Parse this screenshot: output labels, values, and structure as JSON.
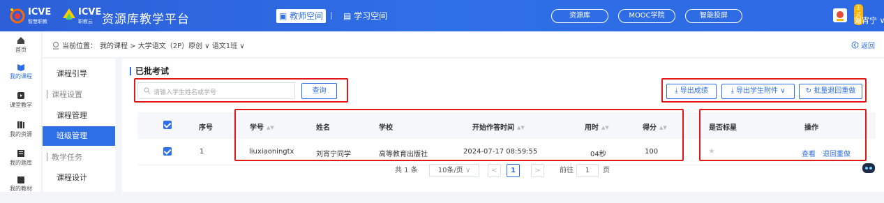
{
  "header": {
    "brand1_main": "ICVE",
    "brand1_sub": "智慧职教",
    "brand2_main": "ICVE",
    "brand2_sub": "职教云",
    "platform_title": "资源库教学平台",
    "teacher_space": "教师空间",
    "separator": "|",
    "study_space": "学习空间",
    "pills": [
      "资源库",
      "MOOC学院",
      "智能投屏"
    ],
    "user_badge": "正式版",
    "user_name": "刘宵宁 ∨"
  },
  "left_nav": [
    {
      "label": "首页",
      "icon": "home-icon"
    },
    {
      "label": "我的课程",
      "icon": "book-icon",
      "active": true
    },
    {
      "label": "课堂教学",
      "icon": "play-icon"
    },
    {
      "label": "我的资源",
      "icon": "resource-icon"
    },
    {
      "label": "我的题库",
      "icon": "question-bank-icon"
    },
    {
      "label": "我的教材",
      "icon": "textbook-icon"
    }
  ],
  "breadcrumb": {
    "prefix": "当前位置：",
    "path": "我的课程 > 大学语文（2P）原创 ∨ 语文1班 ∨",
    "back": "返回"
  },
  "sub_menu": [
    {
      "label": "课程引导",
      "type": "item"
    },
    {
      "label": "课程设置",
      "type": "group"
    },
    {
      "label": "课程管理",
      "type": "item"
    },
    {
      "label": "班级管理",
      "type": "item",
      "active": true
    },
    {
      "label": "教学任务",
      "type": "group"
    },
    {
      "label": "课程设计",
      "type": "item"
    }
  ],
  "content": {
    "section_title": "已批考试",
    "search_placeholder": "请输入学生姓名或学号",
    "query_button": "查询",
    "export_scores": "导出成绩",
    "export_attachments": "导出学生附件",
    "batch_return": "批量退回重做"
  },
  "table": {
    "headers": [
      "序号",
      "学号",
      "姓名",
      "学校",
      "开始作答时间",
      "用时",
      "得分",
      "是否标星",
      "操作"
    ],
    "rows": [
      {
        "index": "1",
        "student_id": "liuxiaoningtx",
        "name": "刘宵宁同学",
        "school": "高等教育出版社",
        "start_time": "2024-07-17 08:59:55",
        "duration": "04秒",
        "score": "100",
        "starred": false,
        "action_view": "查看",
        "action_return": "退回重做"
      }
    ]
  },
  "pagination": {
    "total": "共 1 条",
    "page_size": "10条/页",
    "prev": "<",
    "current": "1",
    "next": ">",
    "goto_prefix": "前往",
    "goto_value": "1",
    "goto_suffix": "页"
  },
  "colors": {
    "accent": "#2f6fe6",
    "highlight_box": "#e01818",
    "header_bg": "#2c5fd8"
  }
}
